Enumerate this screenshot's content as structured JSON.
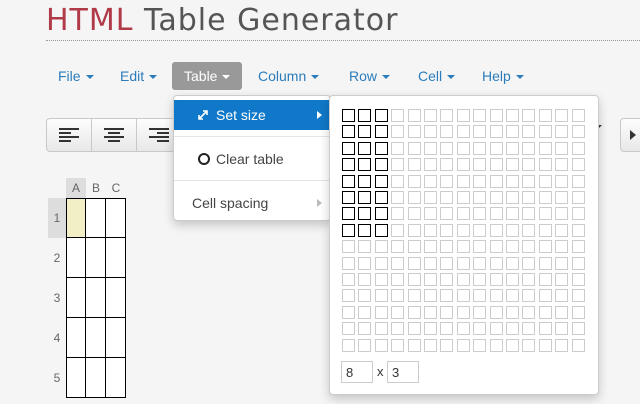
{
  "app": {
    "logo_prefix": "HTML",
    "logo_suffix": " Table Generator"
  },
  "menubar": {
    "items": [
      {
        "label": "File",
        "active": false
      },
      {
        "label": "Edit",
        "active": false
      },
      {
        "label": "Table",
        "active": true
      },
      {
        "label": "Column",
        "active": false
      },
      {
        "label": "Row",
        "active": false
      },
      {
        "label": "Cell",
        "active": false
      },
      {
        "label": "Help",
        "active": false
      }
    ]
  },
  "toolbar": {
    "buttons": [
      {
        "icon": "align-left-icon"
      },
      {
        "icon": "align-center-icon"
      },
      {
        "icon": "align-right-icon"
      }
    ]
  },
  "sheet": {
    "columns": [
      "A",
      "B",
      "C"
    ],
    "rows": [
      "1",
      "2",
      "3",
      "4",
      "5"
    ],
    "selected_cell": "A1",
    "selected_color": "#f2efc7"
  },
  "table_menu": {
    "items": [
      {
        "label": "Set size",
        "icon": "resize-icon",
        "highlighted": true,
        "submenu": true
      },
      {
        "label": "Clear table",
        "icon": "circle-icon",
        "highlighted": false,
        "submenu": false
      },
      {
        "label": "Cell spacing",
        "icon": "",
        "highlighted": false,
        "submenu": true
      }
    ],
    "highlight_color": "#1078c8"
  },
  "size_picker": {
    "columns": 15,
    "rows": 15,
    "selected_rows": 8,
    "selected_cols": 3,
    "rows_value": "8",
    "cols_value": "3",
    "separator": "x"
  },
  "colors": {
    "link": "#2a7cba",
    "logo_accent": "#b03a48"
  }
}
